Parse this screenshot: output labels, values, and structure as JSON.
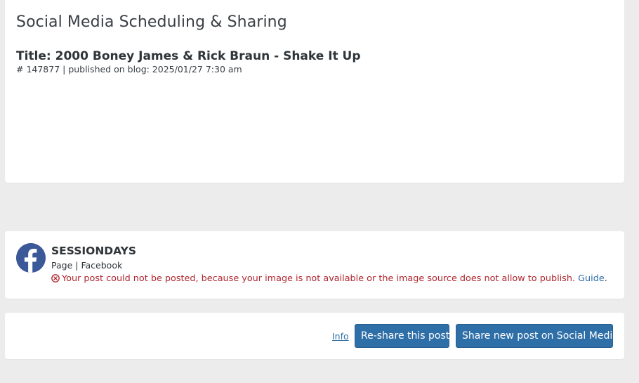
{
  "page": {
    "heading": "Social Media Scheduling & Sharing"
  },
  "post": {
    "title": "Title: 2000 Boney James & Rick Braun - Shake It Up",
    "meta": "# 147877 | published on blog: 2025/01/27 7:30 am"
  },
  "account": {
    "name": "SESSIONDAYS",
    "kind": "Page",
    "separator": "|",
    "network": "Facebook",
    "network_icon": "facebook-icon",
    "network_color": "#3b5998",
    "error_icon": "error-circle-x-icon",
    "error_color": "#b0262f",
    "error_message": "Your post could not be posted, because your image is not available or the image source does not allow to publish.",
    "guide_label": "Guide",
    "guide_trailing": "."
  },
  "actions": {
    "info_label": "Info",
    "reshare_label": "Re-share this post",
    "share_new_label": "Share new post on Social Media",
    "button_color": "#2f6fa8"
  }
}
